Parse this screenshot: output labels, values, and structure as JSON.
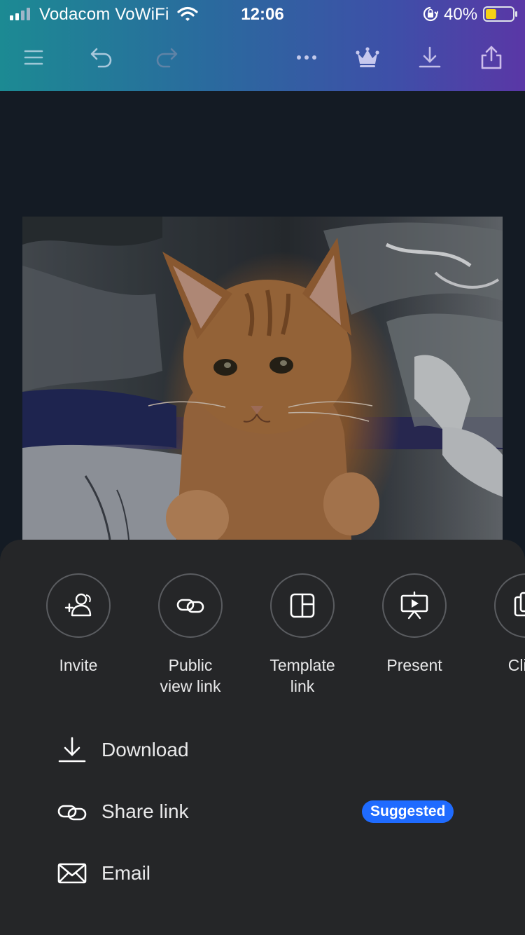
{
  "status_bar": {
    "carrier": "Vodacom VoWiFi",
    "time": "12:06",
    "battery_percent": "40%",
    "battery_level": 0.4,
    "icons": [
      "signal-icon",
      "wifi-icon",
      "orientation-lock-icon",
      "battery-icon"
    ]
  },
  "toolbar": {
    "icons": [
      "menu-icon",
      "undo-icon",
      "redo-icon",
      "more-icon",
      "crown-icon",
      "download-icon",
      "share-icon"
    ]
  },
  "canvas": {
    "image_subject": "kitten-photo"
  },
  "share_sheet": {
    "quick_actions": [
      {
        "label": "Invite",
        "icon": "invite-people-icon"
      },
      {
        "label": "Public\nview link",
        "icon": "link-icon"
      },
      {
        "label": "Template\nlink",
        "icon": "template-icon"
      },
      {
        "label": "Present",
        "icon": "present-icon"
      },
      {
        "label": "Clipb",
        "icon": "clipboard-icon"
      }
    ],
    "list": [
      {
        "label": "Download",
        "icon": "download-icon"
      },
      {
        "label": "Share link",
        "icon": "link-icon",
        "badge": "Suggested"
      },
      {
        "label": "Email",
        "icon": "email-icon"
      }
    ]
  },
  "colors": {
    "header_gradient_start": "#1c8a93",
    "header_gradient_end": "#5a37a6",
    "sheet_background": "#252628",
    "badge_blue": "#1f6bff",
    "battery_yellow": "#f5d214"
  }
}
